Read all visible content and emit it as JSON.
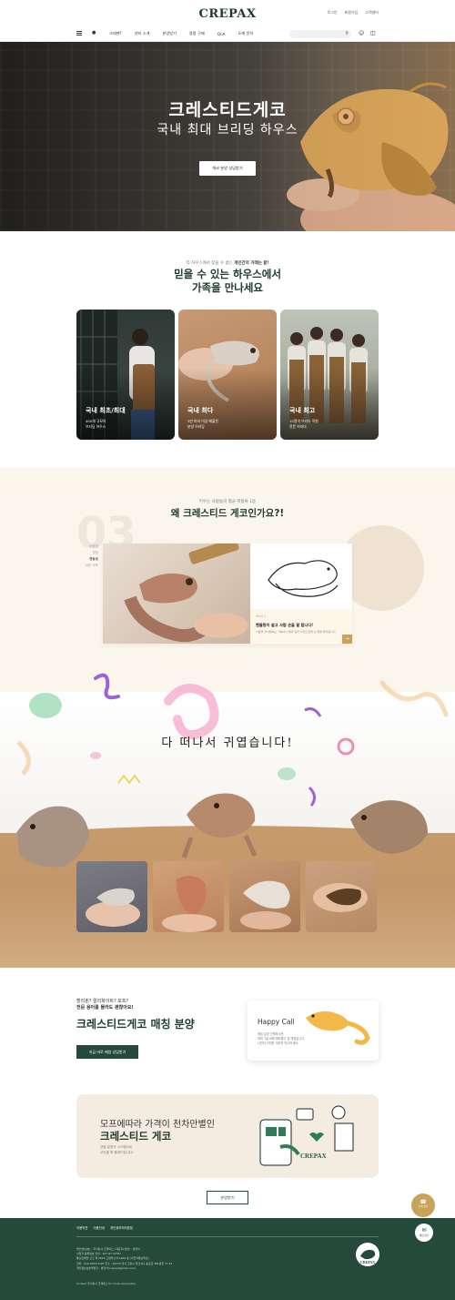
{
  "header": {
    "logo": "CREPAX",
    "top_links": [
      "로그인",
      "회원가입",
      "고객센터"
    ],
    "nav": [
      "크레펜?",
      "센터 소개",
      "분양받기",
      "용품 구매",
      "QnA",
      "도매 문의"
    ]
  },
  "hero": {
    "title": "크레스티드게코",
    "subtitle": "국내 최대 브리딩 하우스",
    "button": "개코 분양 상담받기"
  },
  "family": {
    "eyebrow_pre": "타 하우스에서 찾을 수 없는",
    "eyebrow_bold": "개인간의 거래는 끝!",
    "title_line1": "믿을 수 있는 하우스에서",
    "title_line2": "가족을 만나세요",
    "cards": [
      {
        "title": "국내 최초/최대",
        "desc_line1": "400개 규모의",
        "desc_line2": "브리딩 하우스"
      },
      {
        "title": "국내 최다",
        "desc_line1": "3만 마리 이상 배출된",
        "desc_line2": "분양 브리딩"
      },
      {
        "title": "국내 최고",
        "desc_line1": "10명의 브리더 직원",
        "desc_line2": "전문 브리더"
      }
    ]
  },
  "why": {
    "eyebrow": "키우는 사람들의 평균 파충류 1등",
    "title": "왜 크레스티드 게코인가요?!",
    "big_number": "03",
    "steps": [
      "소형성",
      "성장",
      "핸들링",
      "쉬운 사육"
    ],
    "active_step": 2,
    "point_label": "Point 3.",
    "point_title": "핸들링이 쉽고 사람 손을 잘 탑니다!",
    "point_desc": "사람을 무서워하는 거북이나 뱀과 달리 자연스럽게 손 위에 올라옵니다.",
    "next_arrow": "→"
  },
  "cute": {
    "title": "다 떠나서 귀엽습니다!"
  },
  "matching": {
    "eyebrow_line1": "할리퀸? 릴리화이트? 모프?",
    "eyebrow_line2": "전문 용어를 몰라도 괜찮아요!",
    "title": "크레스티드게코 매칭 분양",
    "button": "지금 바로 매칭 상담받기",
    "happy_title": "Happy Call",
    "happy_desc_line1": "매칭 분양 진행하시면",
    "happy_desc_line2": "최대 7일 내에 해피콜이 갈 예정입니다.",
    "happy_desc_line3": "나만의 귀여운 게코를 만나보세요."
  },
  "promo": {
    "line1": "모프에따라 가격이 천차만별인",
    "line2": "크레스티드 게코",
    "desc_line1": "균일 분양가 시스템으로",
    "desc_line2": "고민을 확 줄여드립니다!",
    "brand": "CREPAX"
  },
  "more_button": "분양받기",
  "fab": {
    "call": "전화 상담",
    "chat": "채팅 상담"
  },
  "footer": {
    "links": [
      "이용약관",
      "이용안내",
      "개인정보처리방침"
    ],
    "info_line1": "법인명(상호) : 주식회사 크레팍스 | 대표자(성명) : 변현석",
    "info_line2": "사업자 등록번호 안내 : 497-87-02781",
    "info_line3": "통신판매업 신고 제 2023-고양일산서-1664 호 [사업자정보확인]",
    "info_line4": "전화 : 010-2964-5495 주소 : 10230 경기 고양시 일산서구 송포로 381번길 77-15",
    "info_line5": "개인정보보호책임자 : 변현석(crepax@gmail.com)",
    "copyright": "Contact 주식회사 크레팍스 for more information."
  },
  "colors": {
    "brand_green": "#25493a",
    "accent_gold": "#c8a35b",
    "cream": "#fbf6ec"
  }
}
